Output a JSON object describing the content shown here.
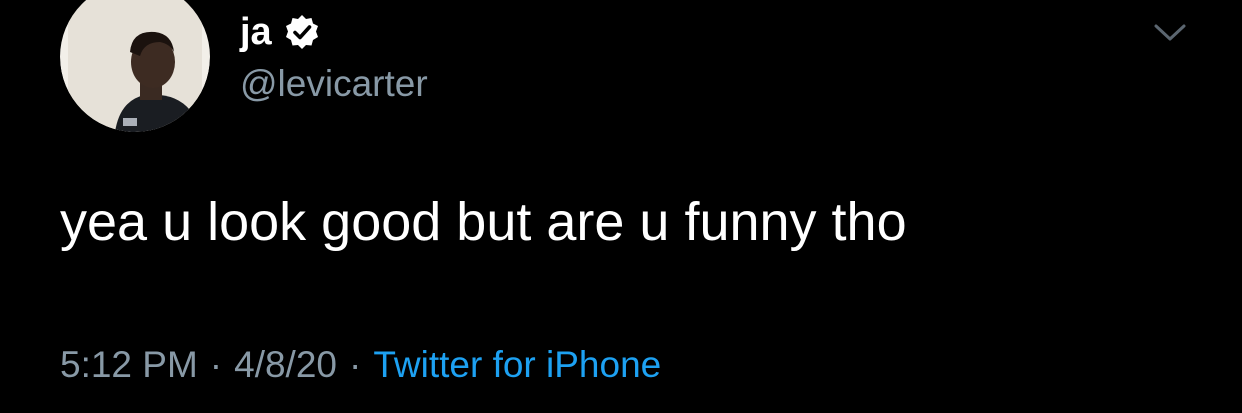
{
  "author": {
    "display_name": "ja",
    "handle": "@levicarter",
    "verified": true,
    "avatar_icon": "profile-photo"
  },
  "tweet": {
    "text": "yea u look good but are u funny tho",
    "time": "5:12 PM",
    "separator": "·",
    "date": "4/8/20",
    "source": "Twitter for iPhone"
  },
  "colors": {
    "background": "#000000",
    "text_primary": "#ffffff",
    "text_secondary": "#8899a6",
    "link": "#1da1f2"
  },
  "icons": {
    "verified": "verified-badge-icon",
    "more": "chevron-down-icon"
  }
}
